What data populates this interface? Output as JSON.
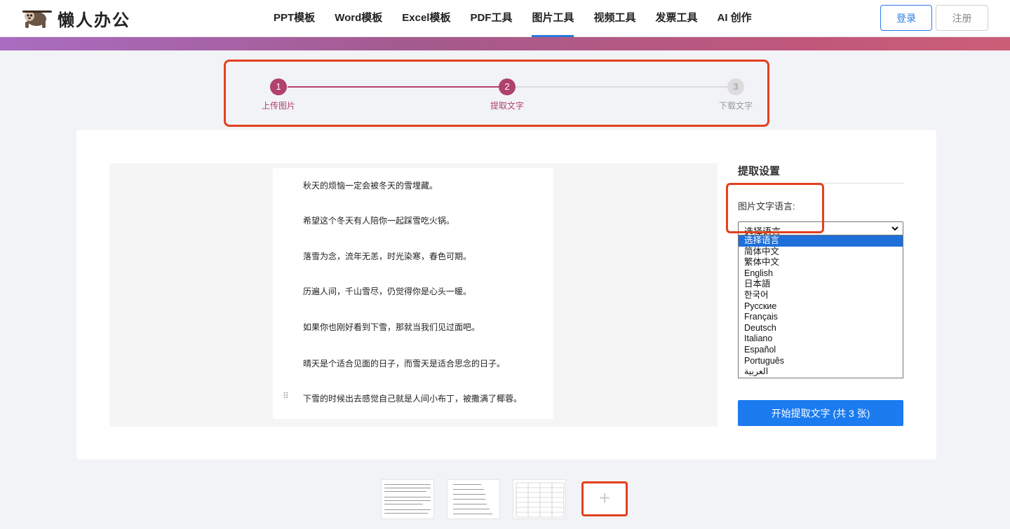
{
  "header": {
    "logo_text": "懒人办公",
    "nav": [
      "PPT模板",
      "Word模板",
      "Excel模板",
      "PDF工具",
      "图片工具",
      "视频工具",
      "发票工具",
      "AI 创作"
    ],
    "active_nav": "图片工具",
    "login": "登录",
    "register": "注册"
  },
  "steps": [
    {
      "num": "1",
      "label": "上传图片",
      "state": "done"
    },
    {
      "num": "2",
      "label": "提取文字",
      "state": "done"
    },
    {
      "num": "3",
      "label": "下载文字",
      "state": "todo"
    }
  ],
  "document": {
    "lines": [
      "秋天的烦恼一定会被冬天的雪埋藏。",
      "希望这个冬天有人陪你一起踩雪吃火锅。",
      "落雪为念，流年无恙，时光染寒，春色可期。",
      "历遍人间，千山雪尽，仍觉得你是心头一暖。",
      "如果你也刚好看到下雪，那就当我们见过面吧。",
      "晴天是个适合见面的日子，而雪天是适合思念的日子。",
      "下雪的时候出去感觉自己就是人间小布丁，被撒满了椰蓉。"
    ],
    "drag_handle": "⠿"
  },
  "settings": {
    "title": "提取设置",
    "language_label": "图片文字语言:",
    "selected": "选择语言",
    "options": [
      "选择语言",
      "简体中文",
      "繁体中文",
      "English",
      "日本語",
      "한국어",
      "Русские",
      "Français",
      "Deutsch",
      "Italiano",
      "Español",
      "Português",
      "العربية"
    ],
    "start_button": "开始提取文字 (共 3 张)"
  },
  "thumbnails": {
    "add_icon": "+"
  },
  "colors": {
    "accent": "#b1416e",
    "primary": "#1b7bef",
    "highlight": "#e3401f"
  }
}
